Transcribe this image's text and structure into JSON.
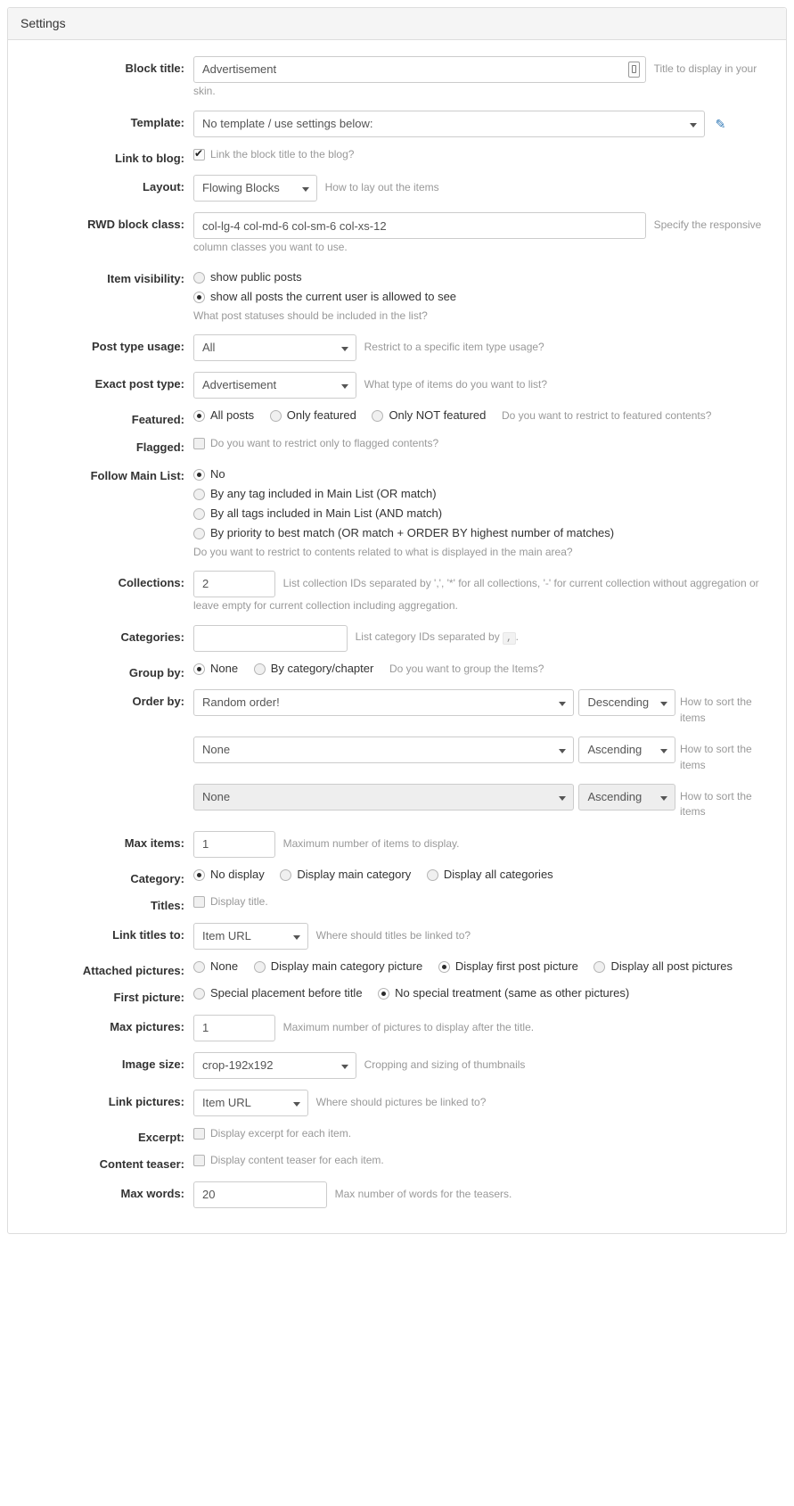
{
  "panel": {
    "title": "Settings"
  },
  "fields": {
    "block_title": {
      "label": "Block title:",
      "value": "Advertisement",
      "hint": "Title to display in your skin.",
      "icon": "mobile-preview-icon"
    },
    "template": {
      "label": "Template:",
      "value": "No template / use settings below:",
      "edit_icon": "edit-pencil-icon"
    },
    "link_to_blog": {
      "label": "Link to blog:",
      "checkbox_label": "Link the block title to the blog?",
      "checked": true
    },
    "layout": {
      "label": "Layout:",
      "value": "Flowing Blocks",
      "hint": "How to lay out the items"
    },
    "rwd_block_class": {
      "label": "RWD block class:",
      "value": "col-lg-4 col-md-6 col-sm-6 col-xs-12",
      "hint": "Specify the responsive column classes you want to use."
    },
    "item_visibility": {
      "label": "Item visibility:",
      "options": [
        {
          "label": "show public posts",
          "selected": false
        },
        {
          "label": "show all posts the current user is allowed to see",
          "selected": true
        }
      ],
      "hint": "What post statuses should be included in the list?"
    },
    "post_type_usage": {
      "label": "Post type usage:",
      "value": "All",
      "hint": "Restrict to a specific item type usage?"
    },
    "exact_post_type": {
      "label": "Exact post type:",
      "value": "Advertisement",
      "hint": "What type of items do you want to list?"
    },
    "featured": {
      "label": "Featured:",
      "options": [
        {
          "label": "All posts",
          "selected": true
        },
        {
          "label": "Only featured",
          "selected": false
        },
        {
          "label": "Only NOT featured",
          "selected": false
        }
      ],
      "hint": "Do you want to restrict to featured contents?"
    },
    "flagged": {
      "label": "Flagged:",
      "checkbox_label": "Do you want to restrict only to flagged contents?",
      "checked": false
    },
    "follow_main_list": {
      "label": "Follow Main List:",
      "options": [
        {
          "label": "No",
          "selected": true
        },
        {
          "label": "By any tag included in Main List (OR match)",
          "selected": false
        },
        {
          "label": "By all tags included in Main List (AND match)",
          "selected": false
        },
        {
          "label": "By priority to best match (OR match + ORDER BY highest number of matches)",
          "selected": false
        }
      ],
      "hint": "Do you want to restrict to contents related to what is displayed in the main area?"
    },
    "collections": {
      "label": "Collections:",
      "value": "2",
      "hint": "List collection IDs separated by ',', '*' for all collections, '-' for current collection without aggregation or leave empty for current collection including aggregation."
    },
    "categories": {
      "label": "Categories:",
      "value": "",
      "hint_before": "List category IDs separated by",
      "hint_code": ",",
      "hint_after": "."
    },
    "group_by": {
      "label": "Group by:",
      "options": [
        {
          "label": "None",
          "selected": true
        },
        {
          "label": "By category/chapter",
          "selected": false
        }
      ],
      "hint": "Do you want to group the Items?"
    },
    "order_by": {
      "label": "Order by:",
      "rows": [
        {
          "field": "Random order!",
          "direction": "Descending",
          "hint": "How to sort the items",
          "disabled": false
        },
        {
          "field": "None",
          "direction": "Ascending",
          "hint": "How to sort the items",
          "disabled": false
        },
        {
          "field": "None",
          "direction": "Ascending",
          "hint": "How to sort the items",
          "disabled": true
        }
      ]
    },
    "max_items": {
      "label": "Max items:",
      "value": "1",
      "hint": "Maximum number of items to display."
    },
    "category": {
      "label": "Category:",
      "options": [
        {
          "label": "No display",
          "selected": true
        },
        {
          "label": "Display main category",
          "selected": false
        },
        {
          "label": "Display all categories",
          "selected": false
        }
      ]
    },
    "titles": {
      "label": "Titles:",
      "checkbox_label": "Display title.",
      "checked": false
    },
    "link_titles_to": {
      "label": "Link titles to:",
      "value": "Item URL",
      "hint": "Where should titles be linked to?"
    },
    "attached_pictures": {
      "label": "Attached pictures:",
      "options": [
        {
          "label": "None",
          "selected": false
        },
        {
          "label": "Display main category picture",
          "selected": false
        },
        {
          "label": "Display first post picture",
          "selected": true
        },
        {
          "label": "Display all post pictures",
          "selected": false
        }
      ]
    },
    "first_picture": {
      "label": "First picture:",
      "options": [
        {
          "label": "Special placement before title",
          "selected": false
        },
        {
          "label": "No special treatment (same as other pictures)",
          "selected": true
        }
      ]
    },
    "max_pictures": {
      "label": "Max pictures:",
      "value": "1",
      "hint": "Maximum number of pictures to display after the title."
    },
    "image_size": {
      "label": "Image size:",
      "value": "crop-192x192",
      "hint": "Cropping and sizing of thumbnails"
    },
    "link_pictures": {
      "label": "Link pictures:",
      "value": "Item URL",
      "hint": "Where should pictures be linked to?"
    },
    "excerpt": {
      "label": "Excerpt:",
      "checkbox_label": "Display excerpt for each item.",
      "checked": false
    },
    "content_teaser": {
      "label": "Content teaser:",
      "checkbox_label": "Display content teaser for each item.",
      "checked": false
    },
    "max_words": {
      "label": "Max words:",
      "value": "20",
      "hint": "Max number of words for the teasers."
    }
  }
}
